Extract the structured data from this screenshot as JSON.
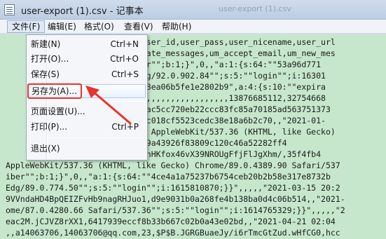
{
  "window": {
    "title": "user-export (1).csv - 记事本",
    "background_title": "user-export (1).csv"
  },
  "menu": [
    {
      "label": "文件(F)"
    },
    {
      "label": "编辑(E)"
    },
    {
      "label": "格式(O)"
    },
    {
      "label": "查看(V)"
    },
    {
      "label": "帮助(H)"
    }
  ],
  "file_menu": {
    "items": [
      {
        "label": "新建(N)",
        "shortcut": "Ctrl+N"
      },
      {
        "label": "打开(O)...",
        "shortcut": "Ctrl+O"
      },
      {
        "label": "保存(S)",
        "shortcut": "Ctrl+S"
      },
      {
        "label": "另存为(A)...",
        "shortcut": ""
      },
      {
        "label": "页面设置(U)...",
        "shortcut": ""
      },
      {
        "label": "打印(P)...",
        "shortcut": "Ctrl+P"
      },
      {
        "label": "退出(X)",
        "shortcut": ""
      }
    ],
    "highlighted_index": 3
  },
  "annotation": {
    "color": "#e8322b"
  },
  "colors": {
    "editor_bg": "#c6e7cb",
    "accent": "#e8322b"
  },
  "lines": [
    "                        rce_user_id,user_pass,user_nicename,user_url",
    "                         private_messages,um_accept_email,um_new_mes",
    "                        criber\"\";b:1;}\",0,,\"a:1:{s:64:\"\"53a96d771",
    "                        36 Edg/92.0.902.84\"\";s:5:\"\"login\"\";i:16301",
    "                        2abe78ea06b5fe1e2802b9\",a:4:{s:10:\"\"expira",
    "                        ,,,,,,,,,,,,,,,,,,,,,,13876685112,32754668",
    "                        fle68ac5cc720eb22ccc83fc85a70185ad563751373",
    "                        8d19ec018cf5523cedc38e18a6b2c70,,\"2021-01-",
    "                         x64) AppleWebKit/537.36 (KHTML, like Gecko)",
    "                   ....4f23ec9a43926f83809c120c46a52282ff4",
    "                   ...,$P$BeChHKfox46vX39NROUgFfjFlJgXhm/,35f4fb4",
    "AppleWebKit/537.36 (KHTML, like Gecko) Chrome/89.0.4389.90 Safari/537",
    "iber\"\";b:1;}\",0,,\"a:1:{s:64:\"\"4ce4a1a75237b6754ceb20b2b58e317e8732b",
    "Edg/89.0.774.50\"\";s:5:\"\"login\"\";i:1615810870;}}\",,,,,\"2021-03-15 20:2",
    "9VVndaHD4BpQEIZFvHb9nagRHJuo1,d9e9031b0a268fe4b138ba0d4c06b514,,\"2021-",
    "ome/87.0.4280.66 Safari/537.36\"\";s:5:\"\"login\"\";i:1614765329;}}\",,,,,\"2",
    "eac2M.jCJVZ8rXX1,6417939eccf8b33b667c02b0a43e02bd,,\"2021-04-21 02:04",
    ",,a14063706,14063706@qq.com,23,$P$B.JGRGBuaeJy/i6rTmcGtZud.wHfCG0,hcc"
  ]
}
